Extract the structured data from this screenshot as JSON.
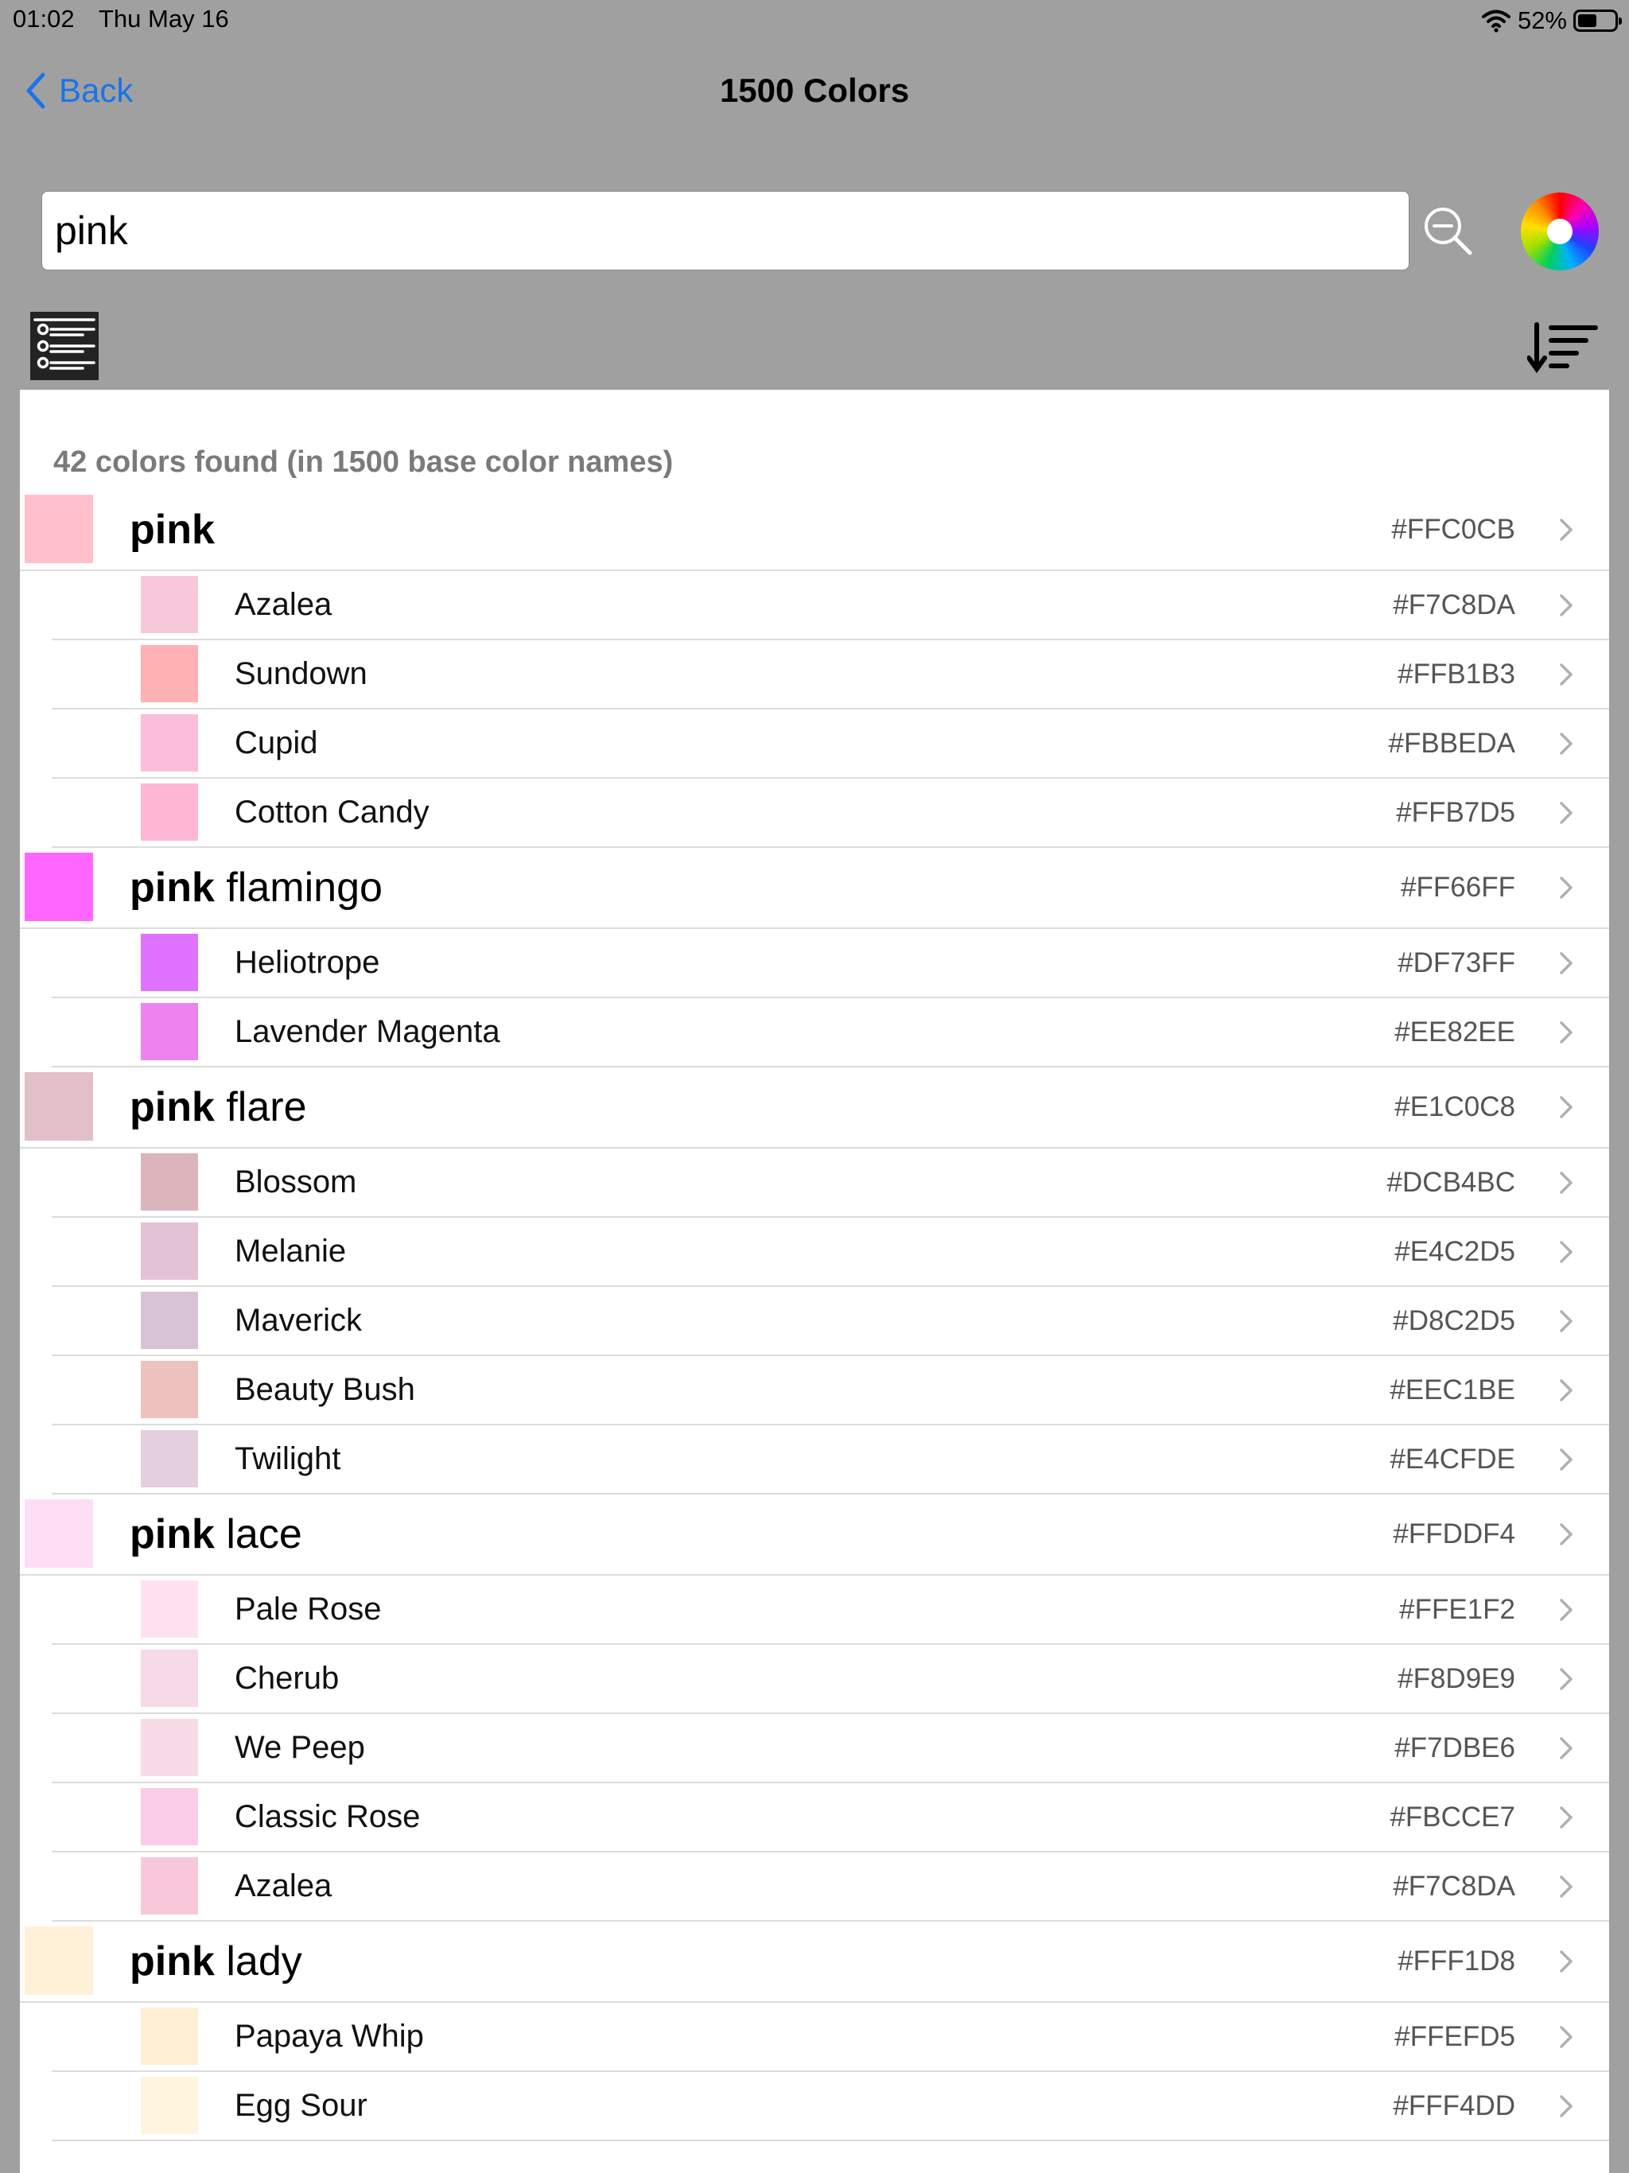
{
  "status_bar": {
    "time": "01:02",
    "date": "Thu May 16",
    "battery_percent": "52%",
    "battery_level": 0.52
  },
  "nav": {
    "back_label": "Back",
    "title": "1500 Colors"
  },
  "search": {
    "value": "pink",
    "placeholder": ""
  },
  "icons": {
    "search": "magnifier-zoom-out-icon",
    "color_wheel": "color-wheel-icon",
    "filter": "list-options-icon",
    "sort": "sort-descending-icon",
    "back": "chevron-left-icon",
    "row": "chevron-right-icon",
    "wifi": "wifi-icon",
    "battery": "battery-icon"
  },
  "colors": {
    "accent": "#1A74E8",
    "background": "#A0A0A0",
    "panel": "#FFFFFF"
  },
  "results_summary": "42 colors found (in 1500 base color names)",
  "rows": [
    {
      "type": "base",
      "prefix": "pink",
      "suffix": "",
      "hex": "#FFC0CB",
      "swatch": "#FFC0CB"
    },
    {
      "type": "sub",
      "name": "Azalea",
      "hex": "#F7C8DA",
      "swatch": "#F7C8DA"
    },
    {
      "type": "sub",
      "name": "Sundown",
      "hex": "#FFB1B3",
      "swatch": "#FFB1B3"
    },
    {
      "type": "sub",
      "name": "Cupid",
      "hex": "#FBBEDA",
      "swatch": "#FBBEDA"
    },
    {
      "type": "sub",
      "name": "Cotton Candy",
      "hex": "#FFB7D5",
      "swatch": "#FFB7D5"
    },
    {
      "type": "base",
      "prefix": "pink",
      "suffix": " flamingo",
      "hex": "#FF66FF",
      "swatch": "#FF66FF"
    },
    {
      "type": "sub",
      "name": "Heliotrope",
      "hex": "#DF73FF",
      "swatch": "#DF73FF"
    },
    {
      "type": "sub",
      "name": "Lavender Magenta",
      "hex": "#EE82EE",
      "swatch": "#EE82EE"
    },
    {
      "type": "base",
      "prefix": "pink",
      "suffix": " flare",
      "hex": "#E1C0C8",
      "swatch": "#E1C0C8"
    },
    {
      "type": "sub",
      "name": "Blossom",
      "hex": "#DCB4BC",
      "swatch": "#DCB4BC"
    },
    {
      "type": "sub",
      "name": "Melanie",
      "hex": "#E4C2D5",
      "swatch": "#E4C2D5"
    },
    {
      "type": "sub",
      "name": "Maverick",
      "hex": "#D8C2D5",
      "swatch": "#D8C2D5"
    },
    {
      "type": "sub",
      "name": "Beauty Bush",
      "hex": "#EEC1BE",
      "swatch": "#EEC1BE"
    },
    {
      "type": "sub",
      "name": "Twilight",
      "hex": "#E4CFDE",
      "swatch": "#E4CFDE"
    },
    {
      "type": "base",
      "prefix": "pink",
      "suffix": " lace",
      "hex": "#FFDDF4",
      "swatch": "#FFDDF4"
    },
    {
      "type": "sub",
      "name": "Pale Rose",
      "hex": "#FFE1F2",
      "swatch": "#FFE1F2"
    },
    {
      "type": "sub",
      "name": "Cherub",
      "hex": "#F8D9E9",
      "swatch": "#F8D9E9"
    },
    {
      "type": "sub",
      "name": "We Peep",
      "hex": "#F7DBE6",
      "swatch": "#F7DBE6"
    },
    {
      "type": "sub",
      "name": "Classic Rose",
      "hex": "#FBCCE7",
      "swatch": "#FBCCE7"
    },
    {
      "type": "sub",
      "name": "Azalea",
      "hex": "#F7C8DA",
      "swatch": "#F7C8DA"
    },
    {
      "type": "base",
      "prefix": "pink",
      "suffix": " lady",
      "hex": "#FFF1D8",
      "swatch": "#FFF1D8"
    },
    {
      "type": "sub",
      "name": "Papaya Whip",
      "hex": "#FFEFD5",
      "swatch": "#FFEFD5"
    },
    {
      "type": "sub",
      "name": "Egg Sour",
      "hex": "#FFF4DD",
      "swatch": "#FFF4DD"
    }
  ]
}
